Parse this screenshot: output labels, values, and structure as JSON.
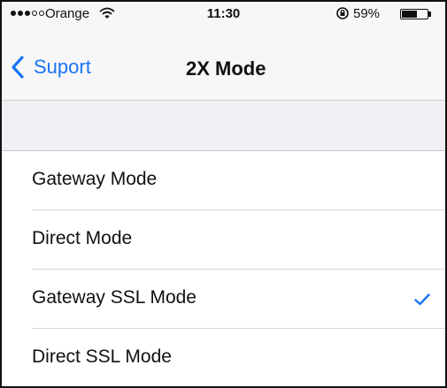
{
  "status_bar": {
    "carrier": "Orange",
    "time": "11:30",
    "battery_percent": "59%",
    "battery_level": 0.59,
    "signal_strength": 3,
    "signal_max": 5
  },
  "nav": {
    "back_label": "Suport",
    "title": "2X Mode"
  },
  "modes": [
    {
      "label": "Gateway Mode",
      "selected": false
    },
    {
      "label": "Direct Mode",
      "selected": false
    },
    {
      "label": "Gateway SSL Mode",
      "selected": true
    },
    {
      "label": "Direct SSL Mode",
      "selected": false
    }
  ],
  "colors": {
    "accent": "#1a74f5",
    "bar_background": "#f7f7f8",
    "section_background": "#efeff4",
    "separator": "#d6d6da"
  },
  "icons": {
    "back": "chevron-left-icon",
    "selected": "checkmark-icon",
    "wifi": "wifi-icon",
    "rotation_lock": "rotation-lock-icon",
    "battery": "battery-icon"
  }
}
